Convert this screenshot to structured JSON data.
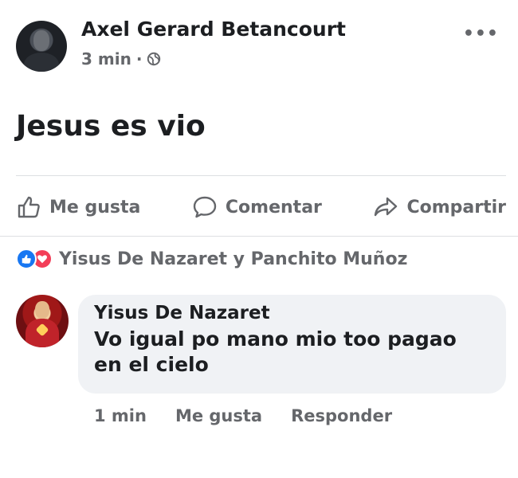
{
  "post": {
    "author": "Axel Gerard Betancourt",
    "time": "3 min",
    "separator": "·",
    "text": "Jesus es vio",
    "more": "•••"
  },
  "actions": {
    "like": "Me gusta",
    "comment": "Comentar",
    "share": "Compartir"
  },
  "reactions": {
    "summary": "Yisus De Nazaret y Panchito Muñoz"
  },
  "comment": {
    "author": "Yisus De Nazaret",
    "text": "Vo igual po mano mio too pagao en el cielo",
    "time": "1 min",
    "like": "Me gusta",
    "reply": "Responder"
  },
  "colors": {
    "like_blue": "#1877f2",
    "love_red": "#f33e58",
    "meta_gray": "#65676b",
    "bubble_bg": "#f0f2f5"
  }
}
